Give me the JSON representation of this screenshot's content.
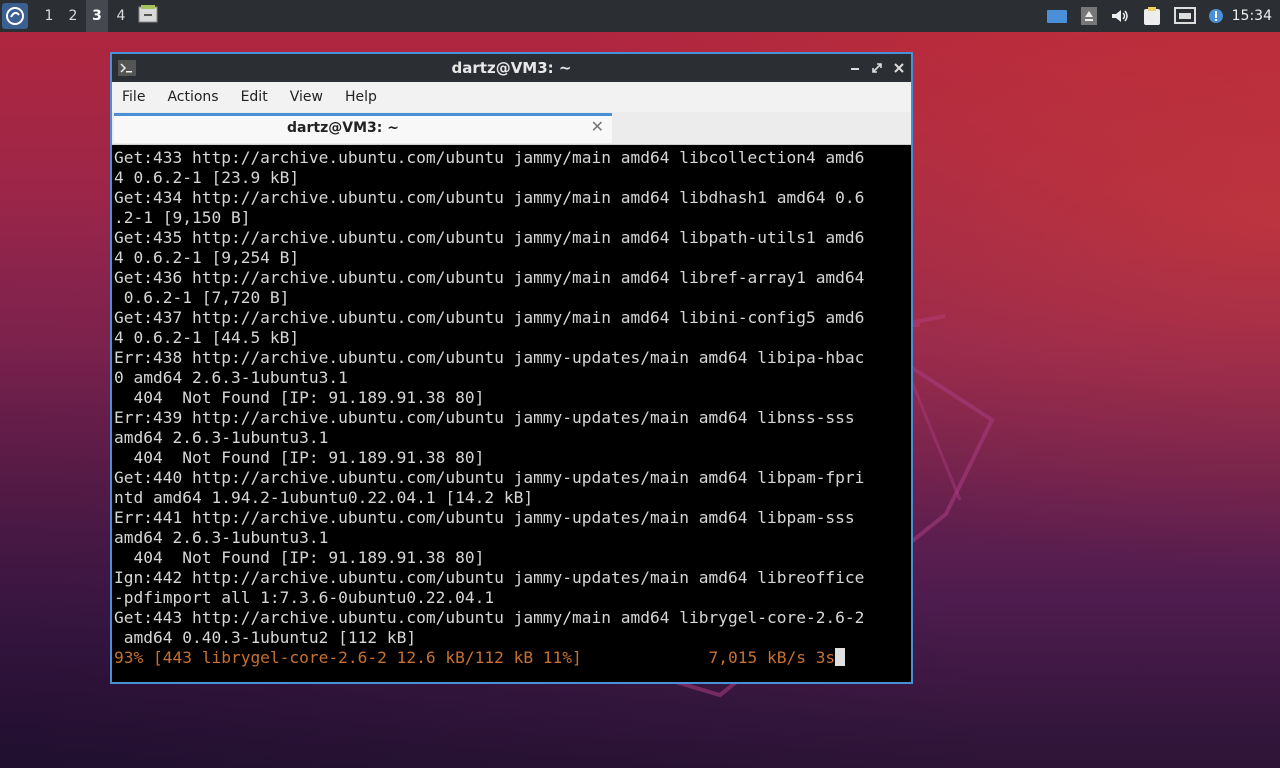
{
  "panel": {
    "workspaces": [
      "1",
      "2",
      "3",
      "4"
    ],
    "active_workspace": "3",
    "clock": "15:34",
    "tray_icons": [
      "display-icon",
      "eject-icon",
      "volume-icon",
      "clipboard-icon",
      "network-icon",
      "notification-icon"
    ]
  },
  "window": {
    "title": "dartz@VM3: ~",
    "menu": [
      "File",
      "Actions",
      "Edit",
      "View",
      "Help"
    ],
    "tab_title": "dartz@VM3: ~"
  },
  "terminal": {
    "lines": [
      "Get:433 http://archive.ubuntu.com/ubuntu jammy/main amd64 libcollection4 amd6",
      "4 0.6.2-1 [23.9 kB]",
      "Get:434 http://archive.ubuntu.com/ubuntu jammy/main amd64 libdhash1 amd64 0.6",
      ".2-1 [9,150 B]",
      "Get:435 http://archive.ubuntu.com/ubuntu jammy/main amd64 libpath-utils1 amd6",
      "4 0.6.2-1 [9,254 B]",
      "Get:436 http://archive.ubuntu.com/ubuntu jammy/main amd64 libref-array1 amd64",
      " 0.6.2-1 [7,720 B]",
      "Get:437 http://archive.ubuntu.com/ubuntu jammy/main amd64 libini-config5 amd6",
      "4 0.6.2-1 [44.5 kB]",
      "Err:438 http://archive.ubuntu.com/ubuntu jammy-updates/main amd64 libipa-hbac",
      "0 amd64 2.6.3-1ubuntu3.1",
      "  404  Not Found [IP: 91.189.91.38 80]",
      "Err:439 http://archive.ubuntu.com/ubuntu jammy-updates/main amd64 libnss-sss",
      "amd64 2.6.3-1ubuntu3.1",
      "  404  Not Found [IP: 91.189.91.38 80]",
      "Get:440 http://archive.ubuntu.com/ubuntu jammy-updates/main amd64 libpam-fpri",
      "ntd amd64 1.94.2-1ubuntu0.22.04.1 [14.2 kB]",
      "Err:441 http://archive.ubuntu.com/ubuntu jammy-updates/main amd64 libpam-sss",
      "amd64 2.6.3-1ubuntu3.1",
      "  404  Not Found [IP: 91.189.91.38 80]",
      "Ign:442 http://archive.ubuntu.com/ubuntu jammy-updates/main amd64 libreoffice",
      "-pdfimport all 1:7.3.6-0ubuntu0.22.04.1",
      "Get:443 http://archive.ubuntu.com/ubuntu jammy/main amd64 librygel-core-2.6-2",
      " amd64 0.40.3-1ubuntu2 [112 kB]"
    ],
    "progress_line": "93% [443 librygel-core-2.6-2 12.6 kB/112 kB 11%]             7,015 kB/s 3s",
    "progress_color": "#c8702f"
  }
}
